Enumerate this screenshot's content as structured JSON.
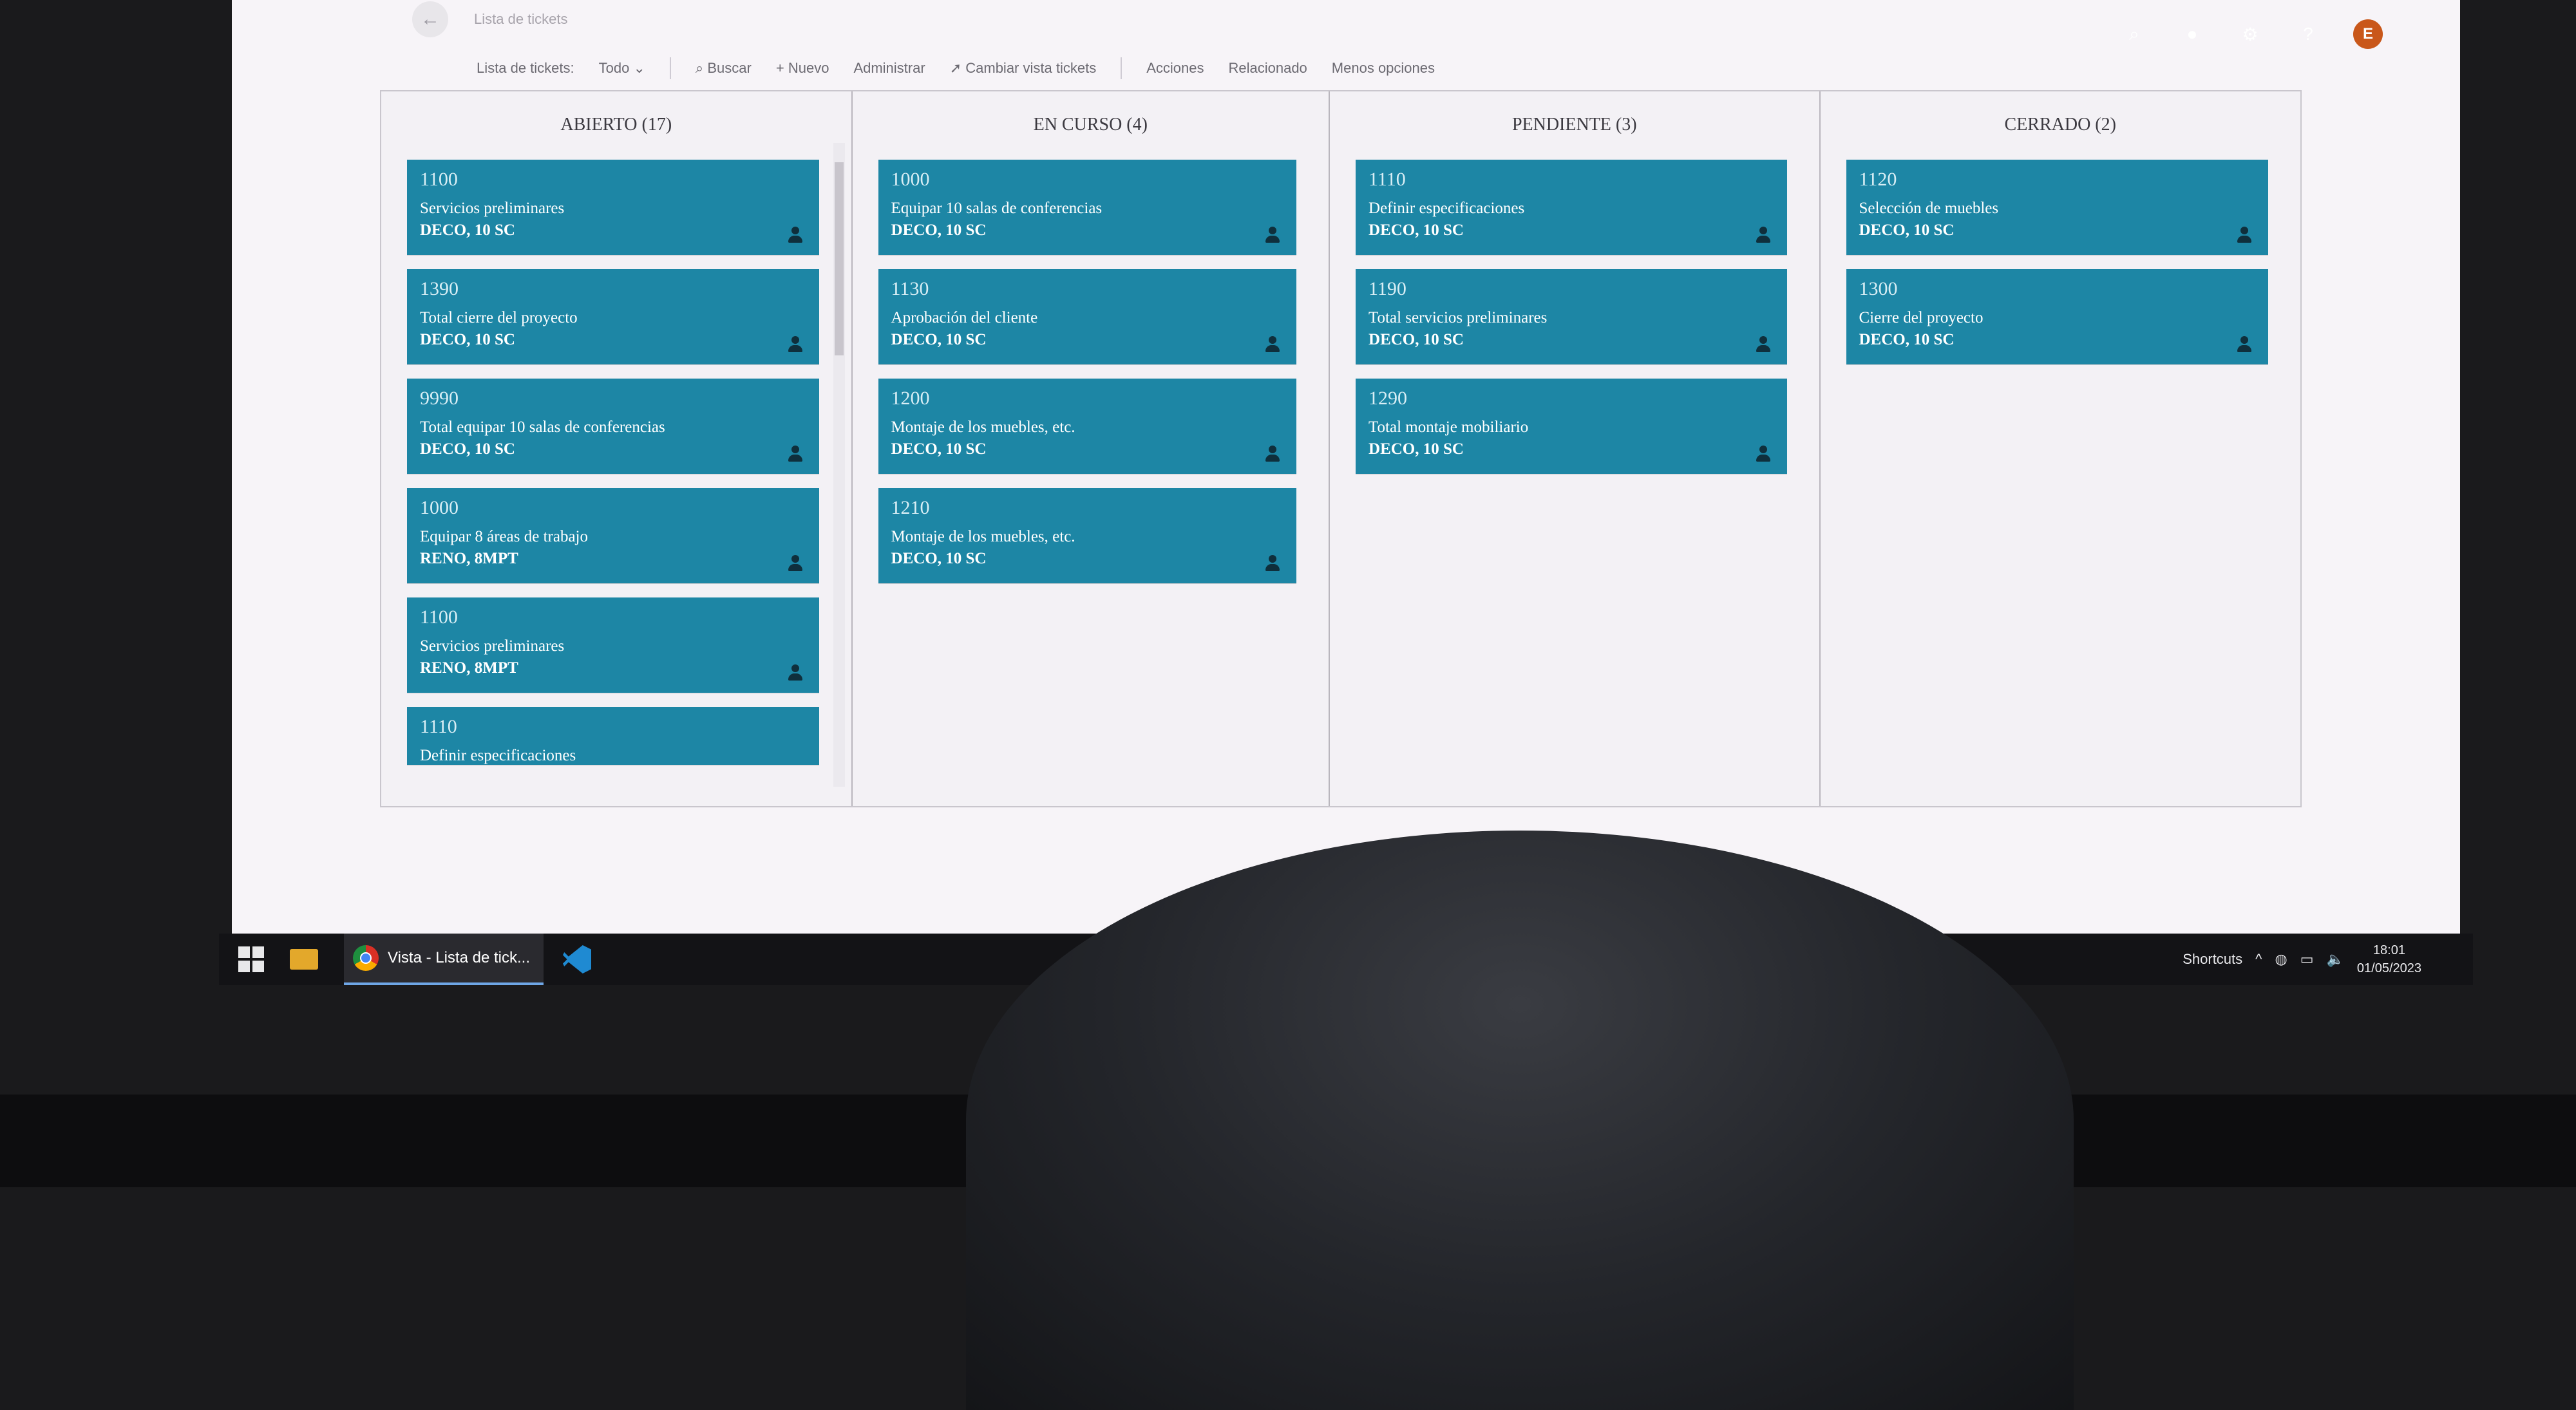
{
  "app": {
    "title": "Lista de tickets",
    "avatar_initial": "E",
    "icons": [
      "search-icon",
      "lightbulb-icon",
      "gear-icon",
      "help-icon"
    ]
  },
  "commandbar": {
    "list_label": "Lista de tickets:",
    "filter_value": "Todo",
    "search": "Buscar",
    "new": "Nuevo",
    "admin": "Administrar",
    "change_view": "Cambiar vista tickets",
    "actions": "Acciones",
    "related": "Relacionado",
    "fewer_options": "Menos opciones"
  },
  "columns": [
    {
      "title": "ABIERTO (17)",
      "cards": [
        {
          "num": "1100",
          "name": "Servicios preliminares",
          "tag": "DECO, 10 SC"
        },
        {
          "num": "1390",
          "name": "Total cierre del proyecto",
          "tag": "DECO, 10 SC"
        },
        {
          "num": "9990",
          "name": "Total equipar 10 salas de conferencias",
          "tag": "DECO, 10 SC"
        },
        {
          "num": "1000",
          "name": "Equipar 8 áreas de trabajo",
          "tag": "RENO, 8MPT"
        },
        {
          "num": "1100",
          "name": "Servicios preliminares",
          "tag": "RENO, 8MPT"
        },
        {
          "num": "1110",
          "name": "Definir especificaciones",
          "tag": ""
        }
      ]
    },
    {
      "title": "EN CURSO (4)",
      "cards": [
        {
          "num": "1000",
          "name": "Equipar 10 salas de conferencias",
          "tag": "DECO, 10 SC"
        },
        {
          "num": "1130",
          "name": "Aprobación del cliente",
          "tag": "DECO, 10 SC"
        },
        {
          "num": "1200",
          "name": "Montaje de los muebles, etc.",
          "tag": "DECO, 10 SC"
        },
        {
          "num": "1210",
          "name": "Montaje de los muebles, etc.",
          "tag": "DECO, 10 SC"
        }
      ]
    },
    {
      "title": "PENDIENTE (3)",
      "cards": [
        {
          "num": "1110",
          "name": "Definir especificaciones",
          "tag": "DECO, 10 SC"
        },
        {
          "num": "1190",
          "name": "Total servicios preliminares",
          "tag": "DECO, 10 SC"
        },
        {
          "num": "1290",
          "name": "Total montaje mobiliario",
          "tag": "DECO, 10 SC"
        }
      ]
    },
    {
      "title": "CERRADO (2)",
      "cards": [
        {
          "num": "1120",
          "name": "Selección de muebles",
          "tag": "DECO, 10 SC"
        },
        {
          "num": "1300",
          "name": "Cierre del proyecto",
          "tag": "DECO, 10 SC"
        }
      ]
    }
  ],
  "taskbar": {
    "chrome_tab": "Vista - Lista de tick...",
    "shortcuts": "Shortcuts",
    "time": "18:01",
    "date": "01/05/2023"
  },
  "colors": {
    "card": "#1d86a5",
    "avatar": "#c9571a"
  }
}
